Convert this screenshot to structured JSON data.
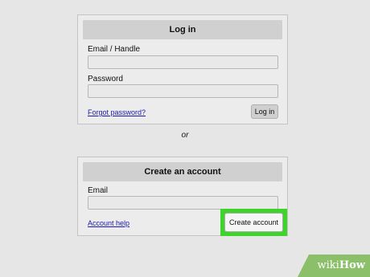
{
  "login": {
    "title": "Log in",
    "email_label": "Email / Handle",
    "email_value": "",
    "password_label": "Password",
    "password_value": "",
    "forgot_link": "Forgot password?",
    "login_button": "Log in"
  },
  "separator": "or",
  "create": {
    "title": "Create an account",
    "email_label": "Email",
    "email_value": "",
    "help_link": "Account help",
    "create_button": "Create account"
  },
  "watermark": {
    "wiki": "wiki",
    "how": "How"
  },
  "colors": {
    "background": "#e6e6e6",
    "header": "#d0d0d0",
    "link": "#1a1ab0",
    "highlight": "#3fd42c",
    "watermark": "#8cbf6a"
  }
}
